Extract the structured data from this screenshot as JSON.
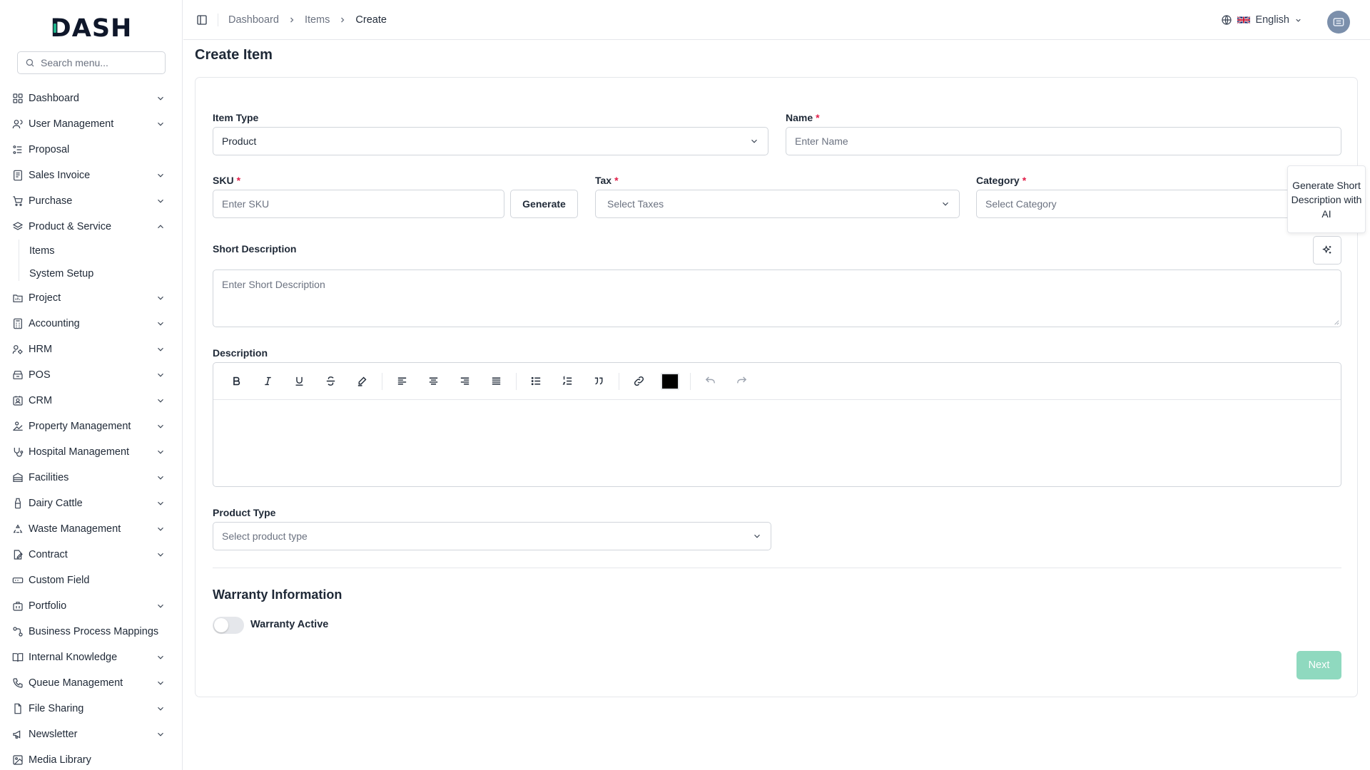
{
  "app": {
    "logo_text": "DASH",
    "accent_color": "#1fb389"
  },
  "search": {
    "placeholder": "Search menu..."
  },
  "sidebar": {
    "items": [
      {
        "label": "Dashboard",
        "icon": "dashboard-grid-icon",
        "expandable": true
      },
      {
        "label": "User Management",
        "icon": "users-icon",
        "expandable": true
      },
      {
        "label": "Proposal",
        "icon": "proposal-icon",
        "expandable": false
      },
      {
        "label": "Sales Invoice",
        "icon": "invoice-icon",
        "expandable": true
      },
      {
        "label": "Purchase",
        "icon": "cart-icon",
        "expandable": true
      },
      {
        "label": "Product & Service",
        "icon": "layers-icon",
        "expandable": true,
        "expanded": true,
        "children": [
          {
            "label": "Items"
          },
          {
            "label": "System Setup"
          }
        ]
      },
      {
        "label": "Project",
        "icon": "project-icon",
        "expandable": true
      },
      {
        "label": "Accounting",
        "icon": "calculator-icon",
        "expandable": true
      },
      {
        "label": "HRM",
        "icon": "hrm-icon",
        "expandable": true
      },
      {
        "label": "POS",
        "icon": "pos-icon",
        "expandable": true
      },
      {
        "label": "CRM",
        "icon": "crm-icon",
        "expandable": true
      },
      {
        "label": "Property Management",
        "icon": "property-icon",
        "expandable": true
      },
      {
        "label": "Hospital Management",
        "icon": "stethoscope-icon",
        "expandable": true
      },
      {
        "label": "Facilities",
        "icon": "facilities-icon",
        "expandable": true
      },
      {
        "label": "Dairy Cattle",
        "icon": "milk-bottle-icon",
        "expandable": true
      },
      {
        "label": "Waste Management",
        "icon": "recycle-icon",
        "expandable": true
      },
      {
        "label": "Contract",
        "icon": "contract-icon",
        "expandable": true
      },
      {
        "label": "Custom Field",
        "icon": "custom-field-icon",
        "expandable": false
      },
      {
        "label": "Portfolio",
        "icon": "briefcase-icon",
        "expandable": true
      },
      {
        "label": "Business Process Mappings",
        "icon": "process-icon",
        "expandable": false
      },
      {
        "label": "Internal Knowledge",
        "icon": "book-icon",
        "expandable": true
      },
      {
        "label": "Queue Management",
        "icon": "phone-icon",
        "expandable": true
      },
      {
        "label": "File Sharing",
        "icon": "file-icon",
        "expandable": true
      },
      {
        "label": "Newsletter",
        "icon": "megaphone-icon",
        "expandable": true
      },
      {
        "label": "Media Library",
        "icon": "image-icon",
        "expandable": false
      }
    ]
  },
  "header": {
    "breadcrumbs": [
      "Dashboard",
      "Items",
      "Create"
    ],
    "language": "English"
  },
  "page": {
    "title": "Create Item"
  },
  "form": {
    "item_type": {
      "label": "Item Type",
      "value": "Product"
    },
    "name": {
      "label": "Name",
      "placeholder": "Enter Name",
      "required_mark": "*"
    },
    "sku": {
      "label": "SKU",
      "placeholder": "Enter SKU",
      "required_mark": "*",
      "generate_label": "Generate"
    },
    "tax": {
      "label": "Tax",
      "placeholder": "Select Taxes",
      "required_mark": "*"
    },
    "category": {
      "label": "Category",
      "placeholder": "Select Category",
      "required_mark": "*"
    },
    "short_description": {
      "label": "Short Description",
      "placeholder": "Enter Short Description",
      "ai_tooltip": "Generate Short Description with AI"
    },
    "description": {
      "label": "Description"
    },
    "product_type": {
      "label": "Product Type",
      "placeholder": "Select product type"
    },
    "warranty": {
      "section_title": "Warranty Information",
      "toggle_label": "Warranty Active",
      "active": false
    },
    "next_label": "Next"
  }
}
